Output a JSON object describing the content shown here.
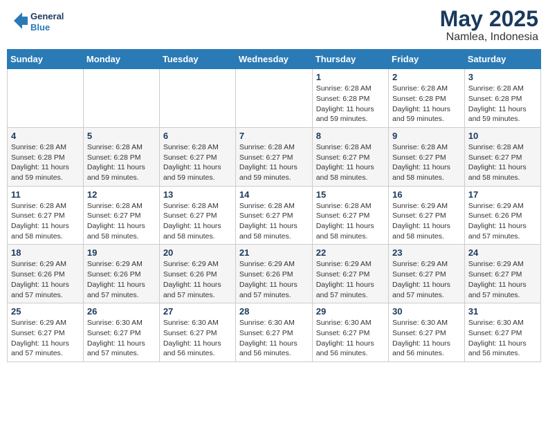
{
  "header": {
    "logo_line1": "General",
    "logo_line2": "Blue",
    "month": "May 2025",
    "location": "Namlea, Indonesia"
  },
  "weekdays": [
    "Sunday",
    "Monday",
    "Tuesday",
    "Wednesday",
    "Thursday",
    "Friday",
    "Saturday"
  ],
  "weeks": [
    [
      {
        "day": "",
        "info": ""
      },
      {
        "day": "",
        "info": ""
      },
      {
        "day": "",
        "info": ""
      },
      {
        "day": "",
        "info": ""
      },
      {
        "day": "1",
        "info": "Sunrise: 6:28 AM\nSunset: 6:28 PM\nDaylight: 11 hours\nand 59 minutes."
      },
      {
        "day": "2",
        "info": "Sunrise: 6:28 AM\nSunset: 6:28 PM\nDaylight: 11 hours\nand 59 minutes."
      },
      {
        "day": "3",
        "info": "Sunrise: 6:28 AM\nSunset: 6:28 PM\nDaylight: 11 hours\nand 59 minutes."
      }
    ],
    [
      {
        "day": "4",
        "info": "Sunrise: 6:28 AM\nSunset: 6:28 PM\nDaylight: 11 hours\nand 59 minutes."
      },
      {
        "day": "5",
        "info": "Sunrise: 6:28 AM\nSunset: 6:28 PM\nDaylight: 11 hours\nand 59 minutes."
      },
      {
        "day": "6",
        "info": "Sunrise: 6:28 AM\nSunset: 6:27 PM\nDaylight: 11 hours\nand 59 minutes."
      },
      {
        "day": "7",
        "info": "Sunrise: 6:28 AM\nSunset: 6:27 PM\nDaylight: 11 hours\nand 59 minutes."
      },
      {
        "day": "8",
        "info": "Sunrise: 6:28 AM\nSunset: 6:27 PM\nDaylight: 11 hours\nand 58 minutes."
      },
      {
        "day": "9",
        "info": "Sunrise: 6:28 AM\nSunset: 6:27 PM\nDaylight: 11 hours\nand 58 minutes."
      },
      {
        "day": "10",
        "info": "Sunrise: 6:28 AM\nSunset: 6:27 PM\nDaylight: 11 hours\nand 58 minutes."
      }
    ],
    [
      {
        "day": "11",
        "info": "Sunrise: 6:28 AM\nSunset: 6:27 PM\nDaylight: 11 hours\nand 58 minutes."
      },
      {
        "day": "12",
        "info": "Sunrise: 6:28 AM\nSunset: 6:27 PM\nDaylight: 11 hours\nand 58 minutes."
      },
      {
        "day": "13",
        "info": "Sunrise: 6:28 AM\nSunset: 6:27 PM\nDaylight: 11 hours\nand 58 minutes."
      },
      {
        "day": "14",
        "info": "Sunrise: 6:28 AM\nSunset: 6:27 PM\nDaylight: 11 hours\nand 58 minutes."
      },
      {
        "day": "15",
        "info": "Sunrise: 6:28 AM\nSunset: 6:27 PM\nDaylight: 11 hours\nand 58 minutes."
      },
      {
        "day": "16",
        "info": "Sunrise: 6:29 AM\nSunset: 6:27 PM\nDaylight: 11 hours\nand 58 minutes."
      },
      {
        "day": "17",
        "info": "Sunrise: 6:29 AM\nSunset: 6:26 PM\nDaylight: 11 hours\nand 57 minutes."
      }
    ],
    [
      {
        "day": "18",
        "info": "Sunrise: 6:29 AM\nSunset: 6:26 PM\nDaylight: 11 hours\nand 57 minutes."
      },
      {
        "day": "19",
        "info": "Sunrise: 6:29 AM\nSunset: 6:26 PM\nDaylight: 11 hours\nand 57 minutes."
      },
      {
        "day": "20",
        "info": "Sunrise: 6:29 AM\nSunset: 6:26 PM\nDaylight: 11 hours\nand 57 minutes."
      },
      {
        "day": "21",
        "info": "Sunrise: 6:29 AM\nSunset: 6:26 PM\nDaylight: 11 hours\nand 57 minutes."
      },
      {
        "day": "22",
        "info": "Sunrise: 6:29 AM\nSunset: 6:27 PM\nDaylight: 11 hours\nand 57 minutes."
      },
      {
        "day": "23",
        "info": "Sunrise: 6:29 AM\nSunset: 6:27 PM\nDaylight: 11 hours\nand 57 minutes."
      },
      {
        "day": "24",
        "info": "Sunrise: 6:29 AM\nSunset: 6:27 PM\nDaylight: 11 hours\nand 57 minutes."
      }
    ],
    [
      {
        "day": "25",
        "info": "Sunrise: 6:29 AM\nSunset: 6:27 PM\nDaylight: 11 hours\nand 57 minutes."
      },
      {
        "day": "26",
        "info": "Sunrise: 6:30 AM\nSunset: 6:27 PM\nDaylight: 11 hours\nand 57 minutes."
      },
      {
        "day": "27",
        "info": "Sunrise: 6:30 AM\nSunset: 6:27 PM\nDaylight: 11 hours\nand 56 minutes."
      },
      {
        "day": "28",
        "info": "Sunrise: 6:30 AM\nSunset: 6:27 PM\nDaylight: 11 hours\nand 56 minutes."
      },
      {
        "day": "29",
        "info": "Sunrise: 6:30 AM\nSunset: 6:27 PM\nDaylight: 11 hours\nand 56 minutes."
      },
      {
        "day": "30",
        "info": "Sunrise: 6:30 AM\nSunset: 6:27 PM\nDaylight: 11 hours\nand 56 minutes."
      },
      {
        "day": "31",
        "info": "Sunrise: 6:30 AM\nSunset: 6:27 PM\nDaylight: 11 hours\nand 56 minutes."
      }
    ]
  ]
}
